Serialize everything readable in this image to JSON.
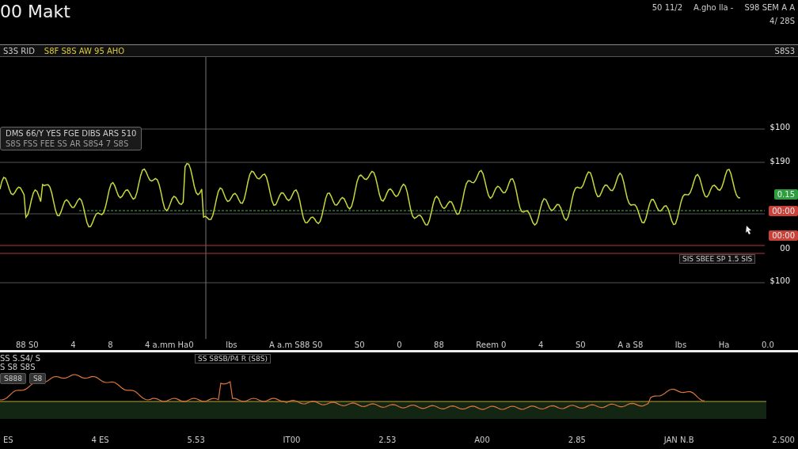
{
  "header": {
    "title": "00 Makt",
    "info": [
      "50 11/2",
      "A.gho lla -",
      "S98 SEM A A"
    ],
    "sub_info": "4/ 28S"
  },
  "toolbar": {
    "left": "S3S RID",
    "symbols": "S8F S8S AW 95 AHO",
    "right": "S8S3"
  },
  "main_chart": {
    "legend": {
      "line_1": "DMS 66/Y YES FGE DIBS ARS 510",
      "line_2": "S8S FSS FEE SS AR S8S4 7 S8S"
    },
    "price_labels": [
      {
        "text": "$100",
        "kind": "plain"
      },
      {
        "text": "$190",
        "kind": "plain"
      },
      {
        "text": "0.15",
        "kind": "up"
      },
      {
        "text": "00:00",
        "kind": "down"
      },
      {
        "text": "00:00",
        "kind": "down"
      },
      {
        "text": "00",
        "kind": "plain"
      },
      {
        "text": "$100",
        "kind": "plain"
      }
    ],
    "note": "SIS SBEE SP 1.5 SIS",
    "time_labels": [
      "88 S0",
      "4",
      "8",
      "4 a.mm Ha0",
      "lbs",
      "A a.m S88 S0",
      "S0",
      "0",
      "88",
      "Reem 0",
      "4",
      "S0",
      "A a S8",
      "lbs",
      "Ha",
      "0.0"
    ]
  },
  "lower_panel": {
    "labels": [
      "SS S.S4/ S",
      "S S8 S8S"
    ],
    "study": "SS S8SB/P4 R (S8S)",
    "buttons": [
      "S888",
      "S8"
    ],
    "time_labels": [
      "ES",
      "4 ES",
      "5.53",
      "IT00",
      "2.53",
      "A00",
      "2.85",
      "JAN N.B",
      "2.S00"
    ]
  }
}
